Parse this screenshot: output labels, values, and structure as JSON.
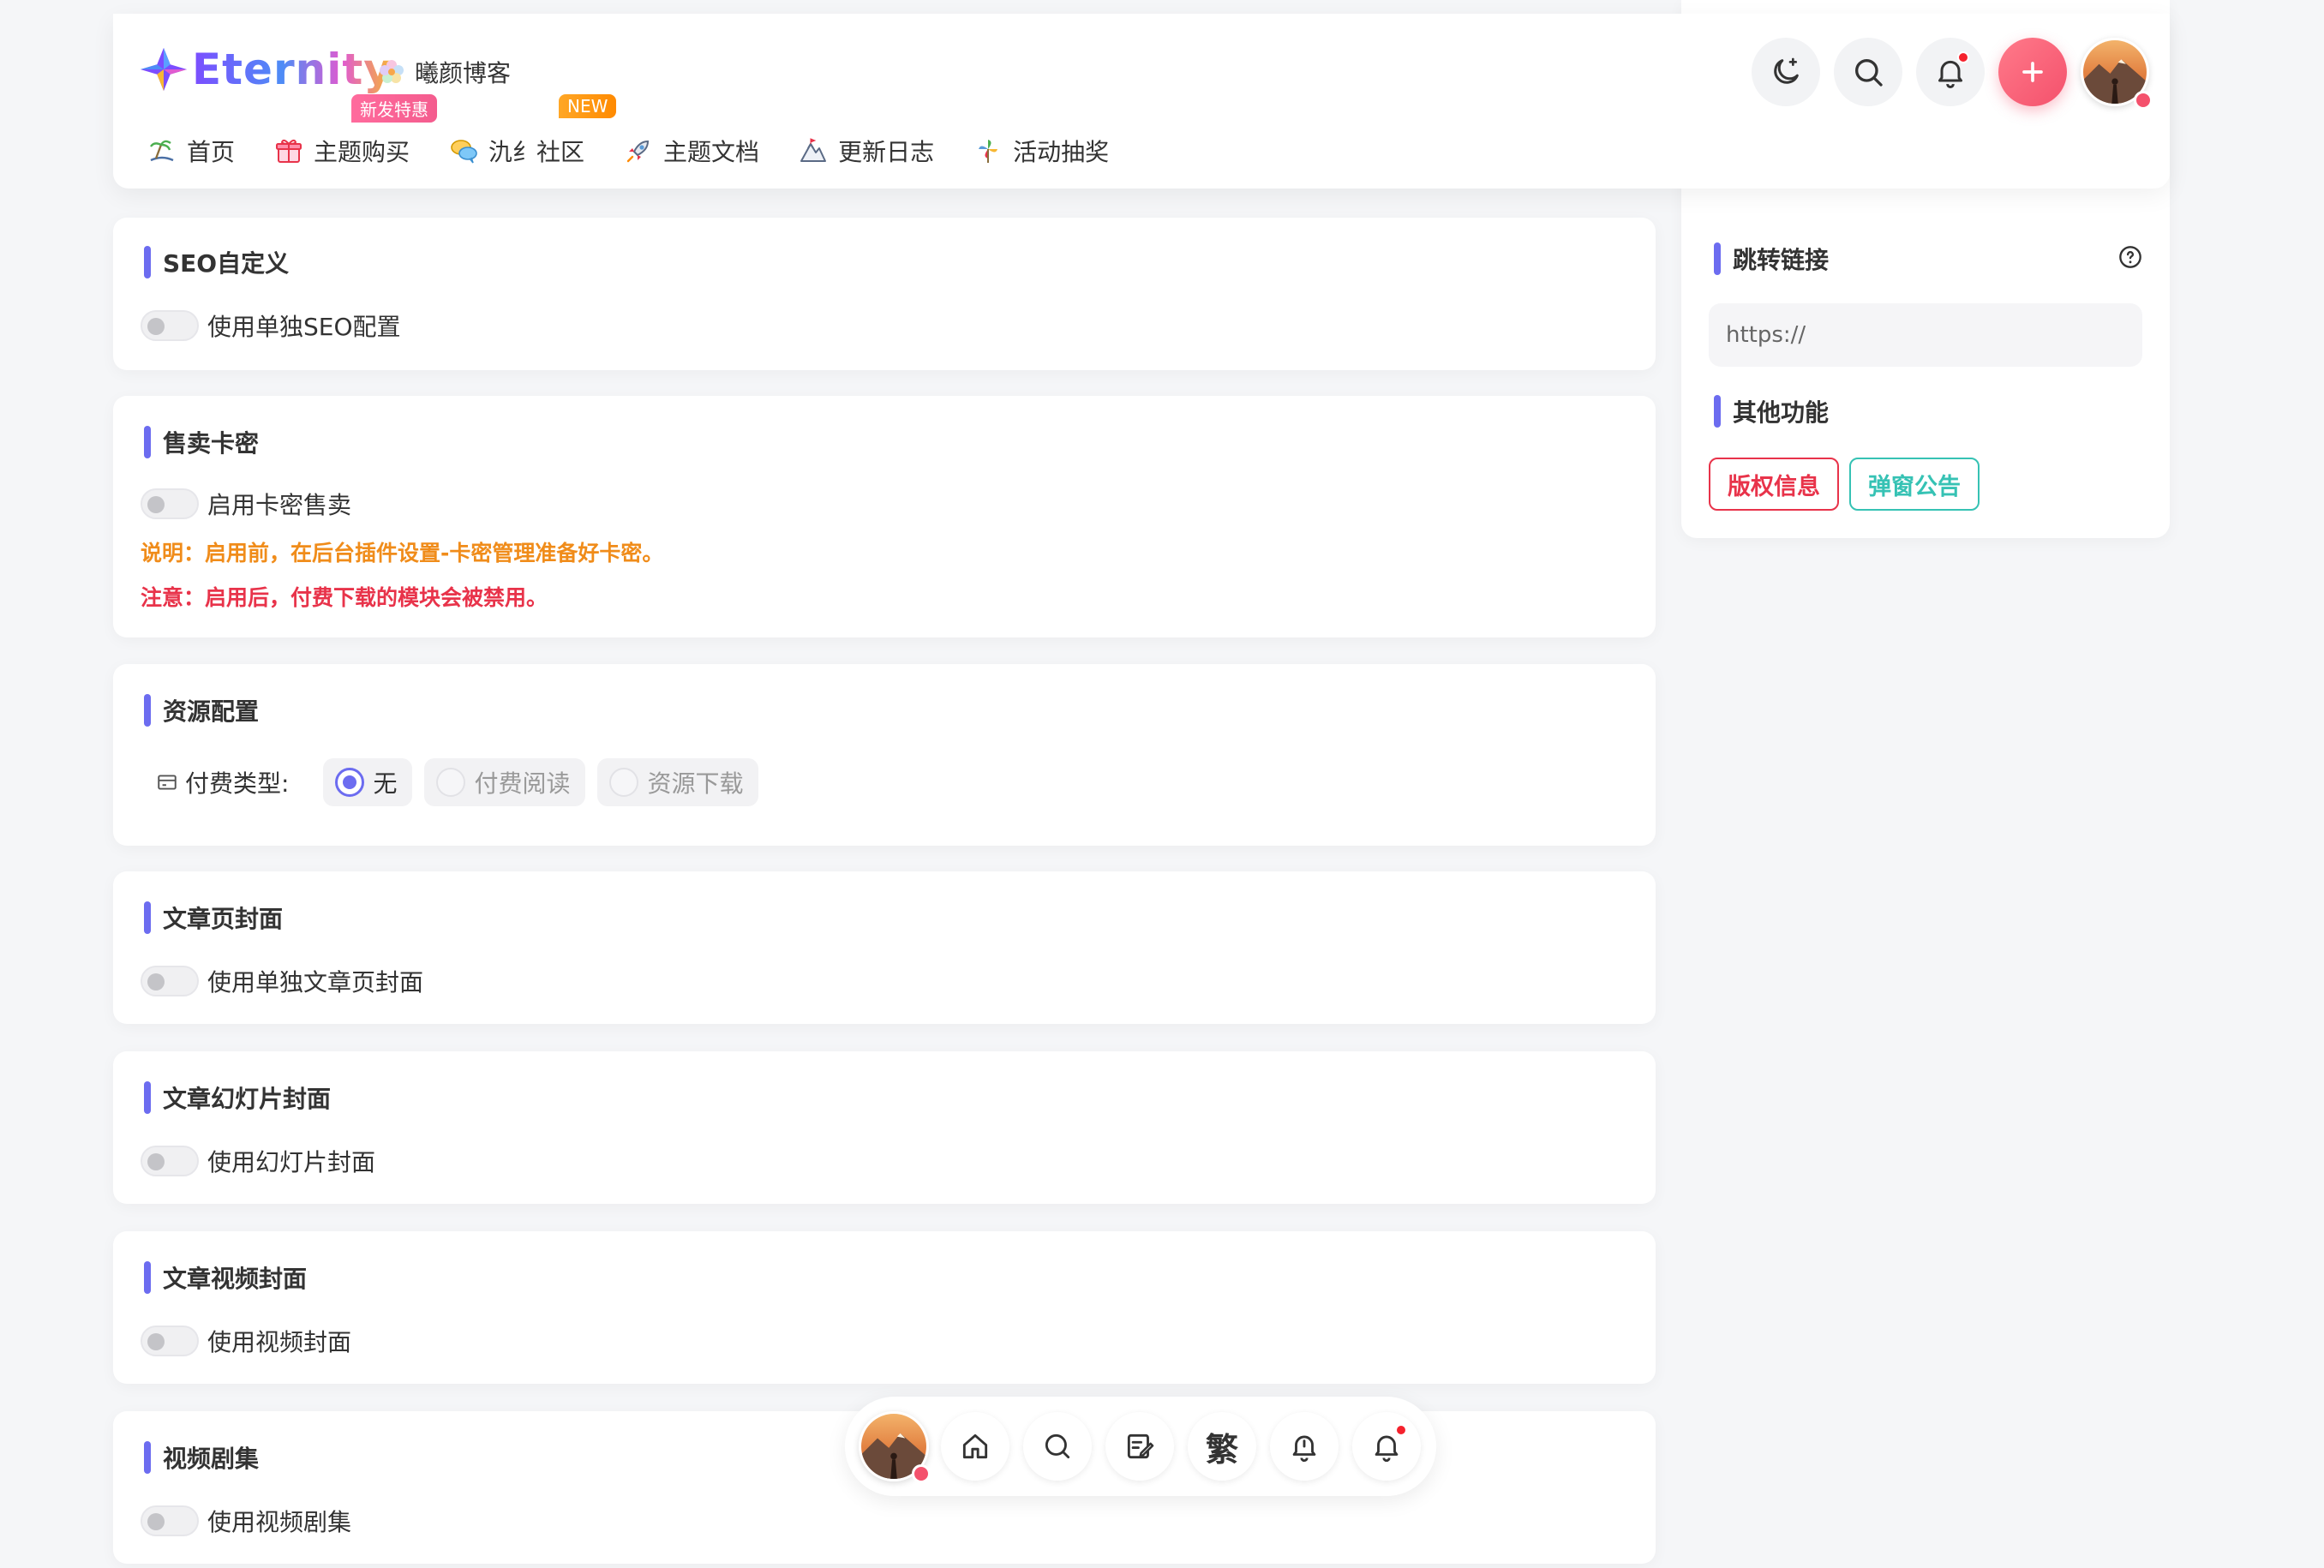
{
  "header": {
    "logo_text": "Eternity",
    "site_name": "曦颜博客",
    "nav": [
      {
        "label": "首页",
        "icon": "beach-icon"
      },
      {
        "label": "主题购买",
        "icon": "gift-icon",
        "badge": "新发特惠"
      },
      {
        "label": "氿纟社区",
        "icon": "chat-bubbles-icon",
        "badge": "NEW"
      },
      {
        "label": "主题文档",
        "icon": "rocket-icon"
      },
      {
        "label": "更新日志",
        "icon": "mountain-icon"
      },
      {
        "label": "活动抽奖",
        "icon": "pinwheel-icon"
      }
    ],
    "actions": [
      "moon-icon",
      "search-icon",
      "bell-icon",
      "plus-icon",
      "avatar"
    ]
  },
  "sections": {
    "seo": {
      "title": "SEO自定义",
      "toggle_label": "使用单独SEO配置"
    },
    "card_key": {
      "title": "售卖卡密",
      "toggle_label": "启用卡密售卖",
      "note1": "说明：启用前，在后台插件设置-卡密管理准备好卡密。",
      "note2": "注意：启用后，付费下载的模块会被禁用。"
    },
    "resource": {
      "title": "资源配置",
      "pay_label": "付费类型:",
      "options": [
        "无",
        "付费阅读",
        "资源下载"
      ],
      "selected": "无"
    },
    "article_cover": {
      "title": "文章页封面",
      "toggle_label": "使用单独文章页封面"
    },
    "slide_cover": {
      "title": "文章幻灯片封面",
      "toggle_label": "使用幻灯片封面"
    },
    "video_cover": {
      "title": "文章视频封面",
      "toggle_label": "使用视频封面"
    },
    "video_series": {
      "title": "视频剧集",
      "toggle_label": "使用视频剧集"
    }
  },
  "sidebar": {
    "redirect": {
      "title": "跳转链接",
      "placeholder": "https://"
    },
    "other": {
      "title": "其他功能",
      "btn_copyright": "版权信息",
      "btn_popup": "弹窗公告"
    }
  },
  "float_bar": {
    "buttons": [
      "avatar",
      "home-icon",
      "search-icon",
      "edit-icon",
      "traditional-chinese-toggle",
      "bell-icon",
      "notification-icon"
    ],
    "trad_label": "繁"
  },
  "colors": {
    "accent": "#6c6cf0",
    "plus_button": "#f4516c",
    "note_orange": "#f08c1a",
    "note_red": "#e8334a",
    "teal": "#36c2b4"
  }
}
